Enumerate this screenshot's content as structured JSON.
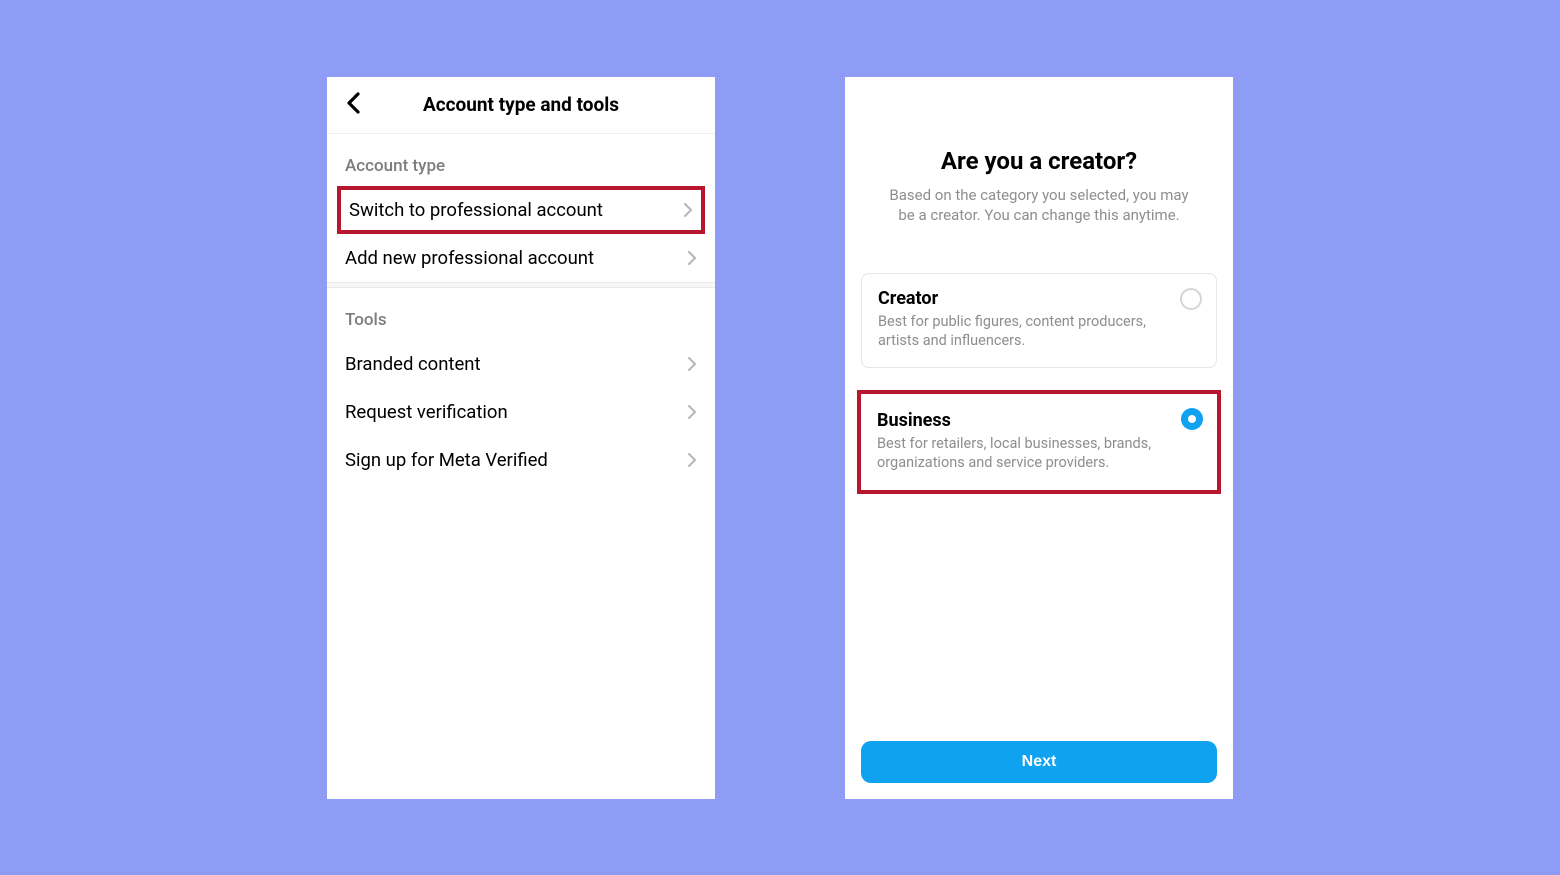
{
  "screen1": {
    "title": "Account type and tools",
    "section_account_type": "Account type",
    "rows_account": [
      {
        "label": "Switch to professional account",
        "highlight": true
      },
      {
        "label": "Add new professional account",
        "highlight": false
      }
    ],
    "section_tools": "Tools",
    "rows_tools": [
      {
        "label": "Branded content"
      },
      {
        "label": "Request verification"
      },
      {
        "label": "Sign up for Meta Verified"
      }
    ]
  },
  "screen2": {
    "title": "Are you a creator?",
    "subtitle": "Based on the category you selected, you may be a creator. You can change this anytime.",
    "options": [
      {
        "title": "Creator",
        "desc": "Best for public figures, content producers, artists and influencers.",
        "selected": false,
        "highlight": false
      },
      {
        "title": "Business",
        "desc": "Best for retailers, local businesses, brands, organizations and service providers.",
        "selected": true,
        "highlight": true
      }
    ],
    "next_label": "Next"
  },
  "colors": {
    "background": "#8f9cf5",
    "accent_blue": "#0fa2f0",
    "highlight_red": "#b7172c"
  }
}
